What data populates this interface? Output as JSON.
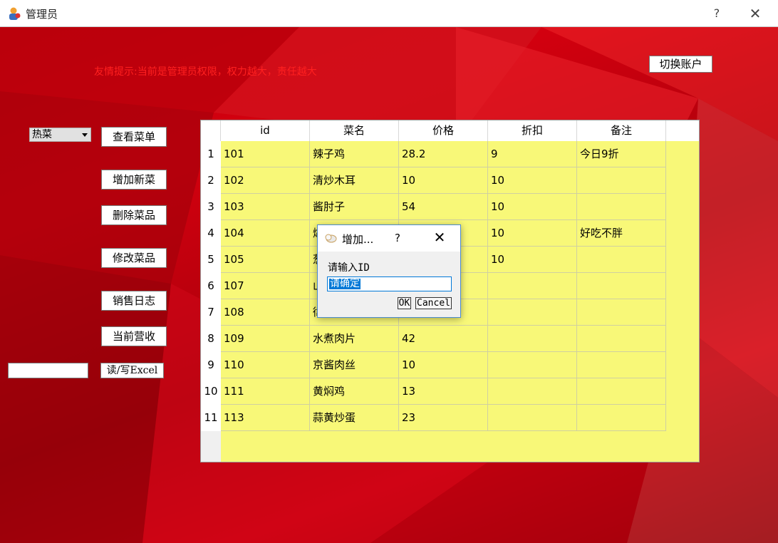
{
  "window": {
    "title": "管理员",
    "help": "?",
    "close": "✕"
  },
  "tip": "友情提示:当前是管理员权限，权力越大，责任越大",
  "switch_account": "切换账户",
  "category_combo": {
    "selected": "热菜"
  },
  "buttons": {
    "view_menu": "查看菜单",
    "add_dish": "增加新菜",
    "delete_dish": "删除菜品",
    "modify_dish": "修改菜品",
    "sales_log": "销售日志",
    "current_revenue": "当前营收",
    "excel": "读/写Excel"
  },
  "table": {
    "headers": [
      "id",
      "菜名",
      "价格",
      "折扣",
      "备注"
    ],
    "rows": [
      {
        "num": "1",
        "cells": [
          "101",
          "辣子鸡",
          "28.2",
          "9",
          "今日9折"
        ]
      },
      {
        "num": "2",
        "cells": [
          "102",
          "清炒木耳",
          "10",
          "10",
          ""
        ]
      },
      {
        "num": "3",
        "cells": [
          "103",
          "酱肘子",
          "54",
          "10",
          ""
        ]
      },
      {
        "num": "4",
        "cells": [
          "104",
          "煳",
          "",
          "10",
          "好吃不胖"
        ]
      },
      {
        "num": "5",
        "cells": [
          "105",
          "葱",
          "",
          "10",
          ""
        ]
      },
      {
        "num": "6",
        "cells": [
          "107",
          "山",
          "",
          "",
          ""
        ]
      },
      {
        "num": "7",
        "cells": [
          "108",
          "徫",
          "",
          "",
          ""
        ]
      },
      {
        "num": "8",
        "cells": [
          "109",
          "水煮肉片",
          "42",
          "",
          ""
        ]
      },
      {
        "num": "9",
        "cells": [
          "110",
          "京酱肉丝",
          "10",
          "",
          ""
        ]
      },
      {
        "num": "10",
        "cells": [
          "111",
          "黄焖鸡",
          "13",
          "",
          ""
        ]
      },
      {
        "num": "11",
        "cells": [
          "113",
          "蒜黄炒蛋",
          "23",
          "",
          ""
        ]
      }
    ]
  },
  "dialog": {
    "title": "增加...",
    "help": "?",
    "close": "✕",
    "prompt": "请输入ID",
    "input_value": "请确定",
    "ok": "OK",
    "cancel": "Cancel"
  }
}
